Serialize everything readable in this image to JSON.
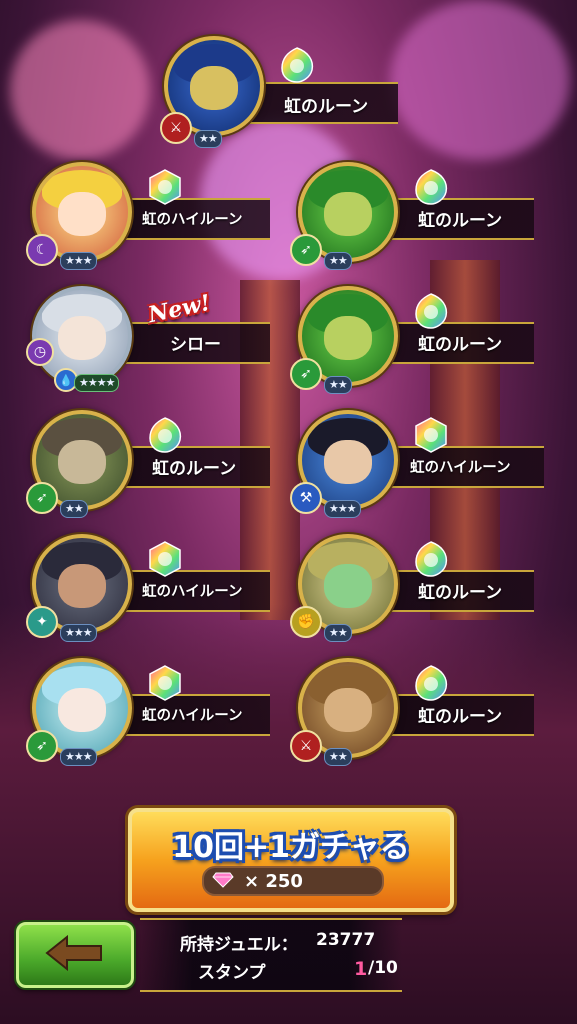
{
  "summons": [
    {
      "name": "虹のルーン",
      "stars": "★★",
      "new": false
    },
    {
      "name": "虹のハイルーン",
      "stars": "★★★",
      "new": false
    },
    {
      "name": "虹のルーン",
      "stars": "★★",
      "new": false
    },
    {
      "name": "シロー",
      "stars": "★★★★",
      "new": true
    },
    {
      "name": "虹のルーン",
      "stars": "★★",
      "new": false
    },
    {
      "name": "虹のルーン",
      "stars": "★★",
      "new": false
    },
    {
      "name": "虹のハイルーン",
      "stars": "★★★",
      "new": false
    },
    {
      "name": "虹のハイルーン",
      "stars": "★★★",
      "new": false
    },
    {
      "name": "虹のルーン",
      "stars": "★★",
      "new": false
    },
    {
      "name": "虹のハイルーン",
      "stars": "★★★",
      "new": false
    },
    {
      "name": "虹のルーン",
      "stars": "★★",
      "new": false
    }
  ],
  "new_badge": "New!",
  "gacha_button": {
    "label": "10回+1ガチャる",
    "cost": "× 250"
  },
  "info": {
    "jewel_label": "所持ジュエル：",
    "jewel_value": "23777",
    "stamp_label": "スタンプ",
    "stamp_current": "1",
    "stamp_total": "/10"
  },
  "colors": {
    "gold": "#c9a63b",
    "button_orange": "#f6a21e",
    "back_green": "#4aa82a"
  }
}
